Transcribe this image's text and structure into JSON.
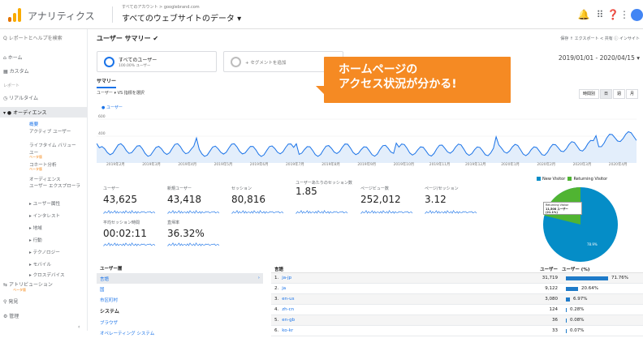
{
  "topbar": {
    "app_title": "アナリティクス",
    "account_path": "すべてのアカウント > googlebrand.com",
    "view_name": "すべてのウェブサイトのデータ ▾",
    "icons": [
      "notifications-icon",
      "apps-icon",
      "help-icon",
      "more-icon"
    ],
    "brand_colors": {
      "orange": "#f9ab00",
      "dark_orange": "#e37400"
    }
  },
  "sidebar": {
    "search_placeholder": "Q  レポートとヘルプを検索",
    "items": [
      {
        "label": "ホーム",
        "icon": "home-icon"
      },
      {
        "label": "カスタム",
        "icon": "custom-icon"
      },
      {
        "label": "レポート",
        "icon": ""
      },
      {
        "label": "リアルタイム",
        "icon": "clock-icon"
      },
      {
        "label": "オーディエンス",
        "icon": "person-icon"
      }
    ],
    "sub_items": [
      {
        "label": "概要",
        "selected": true
      },
      {
        "label": "アクティブ ユーザー"
      },
      {
        "label": "ライフタイム バリュー"
      },
      {
        "label": "ユー"
      },
      {
        "label": "コホート分析"
      },
      {
        "label": "オーディエンス"
      },
      {
        "label": "ユーザー エクスプローラ"
      },
      {
        "label": "▸ ユーザー属性"
      },
      {
        "label": "▸ インタレスト"
      },
      {
        "label": "▸ 地域"
      },
      {
        "label": "▸ 行動"
      },
      {
        "label": "▸ テクノロジー"
      },
      {
        "label": "▸ モバイル"
      },
      {
        "label": "▸ クロスデバイス"
      }
    ],
    "badge": "ベータ版",
    "attribution": "アトリビューション",
    "discover": "発見",
    "admin": "管理"
  },
  "report": {
    "title": "ユーザー サマリー ✔",
    "tools": "保存   ↑ エクスポート   < 共有   ⓘ インサイト",
    "segment_all": "すべてのユーザー",
    "segment_all_sub": "100.00% ユーザー",
    "segment_add": "+ セグメントを追加",
    "date_range": "2019/01/01 - 2020/04/15 ▾",
    "tab_summary": "サマリー",
    "metric_select": "ユーザー ▾  VS  指標を選択",
    "period": [
      "時間別",
      "日",
      "週",
      "月"
    ],
    "legend_label": "● ユーザー",
    "y_ticks": [
      "600",
      "400",
      "200"
    ],
    "months": [
      "2019年2月",
      "2019年3月",
      "2019年4月",
      "2019年5月",
      "2019年6月",
      "2019年7月",
      "2019年8月",
      "2019年9月",
      "2019年10月",
      "2019年11月",
      "2019年12月",
      "2020年1月",
      "2020年2月",
      "2020年3月",
      "2020年4月"
    ]
  },
  "callout": {
    "line1": "ホームページの",
    "line2": "アクセス状況が分かる!"
  },
  "metrics": [
    {
      "label": "ユーザー",
      "value": "43,625"
    },
    {
      "label": "新規ユーザー",
      "value": "43,418"
    },
    {
      "label": "セッション",
      "value": "80,816"
    },
    {
      "label": "ユーザーあたりのセッション数",
      "value": "1.85"
    },
    {
      "label": "ページビュー数",
      "value": "252,012"
    },
    {
      "label": "ページ/セッション",
      "value": "3.12"
    },
    {
      "label": "平均セッション時間",
      "value": "00:02:11"
    },
    {
      "label": "直帰率",
      "value": "36.32%"
    }
  ],
  "pie": {
    "legend_new": "New Visitor",
    "legend_returning": "Returning Visitor",
    "tooltip_title": "Returning Visitor",
    "tooltip_value": "11,508 ユーザー (21.1%)",
    "new_pct": "78.9%",
    "colors": {
      "new": "#058dc7",
      "returning": "#50b432"
    }
  },
  "bottom_left": {
    "header": "ユーザー層",
    "lang": "言語",
    "country": "国",
    "city": "市区町村",
    "system": "システム",
    "browser": "ブラウザ",
    "os": "オペレーティング システム"
  },
  "lang_table": {
    "col_lang": "言語",
    "col_users": "ユーザー",
    "col_users_pct": "ユーザー  (%)",
    "rows": [
      {
        "rank": "1.",
        "lang": "ja-jp",
        "users": "31,719",
        "pct": "71.76%",
        "fraction": 0.7176
      },
      {
        "rank": "2.",
        "lang": "ja",
        "users": "9,122",
        "pct": "20.64%",
        "fraction": 0.2064
      },
      {
        "rank": "3.",
        "lang": "en-us",
        "users": "3,080",
        "pct": "6.97%",
        "fraction": 0.0697
      },
      {
        "rank": "4.",
        "lang": "zh-cn",
        "users": "124",
        "pct": "0.28%",
        "fraction": 0.0028
      },
      {
        "rank": "5.",
        "lang": "en-gb",
        "users": "36",
        "pct": "0.08%",
        "fraction": 0.0008
      },
      {
        "rank": "6.",
        "lang": "ko-kr",
        "users": "33",
        "pct": "0.07%",
        "fraction": 0.0007
      }
    ]
  }
}
